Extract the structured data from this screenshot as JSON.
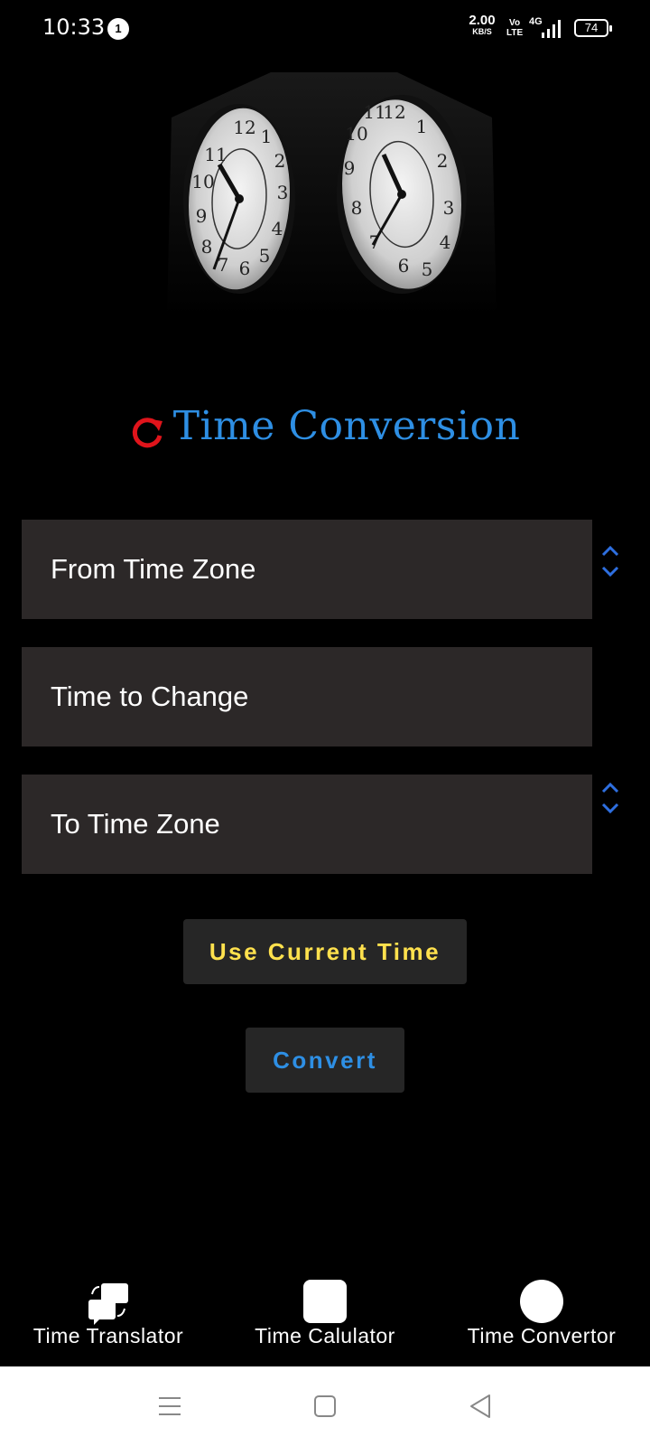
{
  "status_bar": {
    "time": "10:33",
    "notification_count": "1",
    "net_speed_value": "2.00",
    "net_speed_unit": "KB/S",
    "volte_top": "Vo",
    "volte_bottom": "LTE",
    "network": "4G",
    "battery": "74"
  },
  "title": {
    "text": "Time Conversion",
    "color": "#2e8fe4",
    "icon": "refresh-icon",
    "icon_color": "#e0141b"
  },
  "form": {
    "from_zone_label": "From Time Zone",
    "time_label": "Time to Change",
    "to_zone_label": "To Time Zone"
  },
  "buttons": {
    "current_time": "Use Current Time",
    "current_time_color": "#ffe14d",
    "convert": "Convert",
    "convert_color": "#2e8fe4"
  },
  "tabs": [
    {
      "label": "Time Translator",
      "icon": "translate-chat-icon"
    },
    {
      "label": "Time Calulator",
      "icon": "rounded-square-icon"
    },
    {
      "label": "Time Convertor",
      "icon": "circle-icon"
    }
  ],
  "system_nav": [
    "menu-icon",
    "home-icon",
    "back-icon"
  ]
}
